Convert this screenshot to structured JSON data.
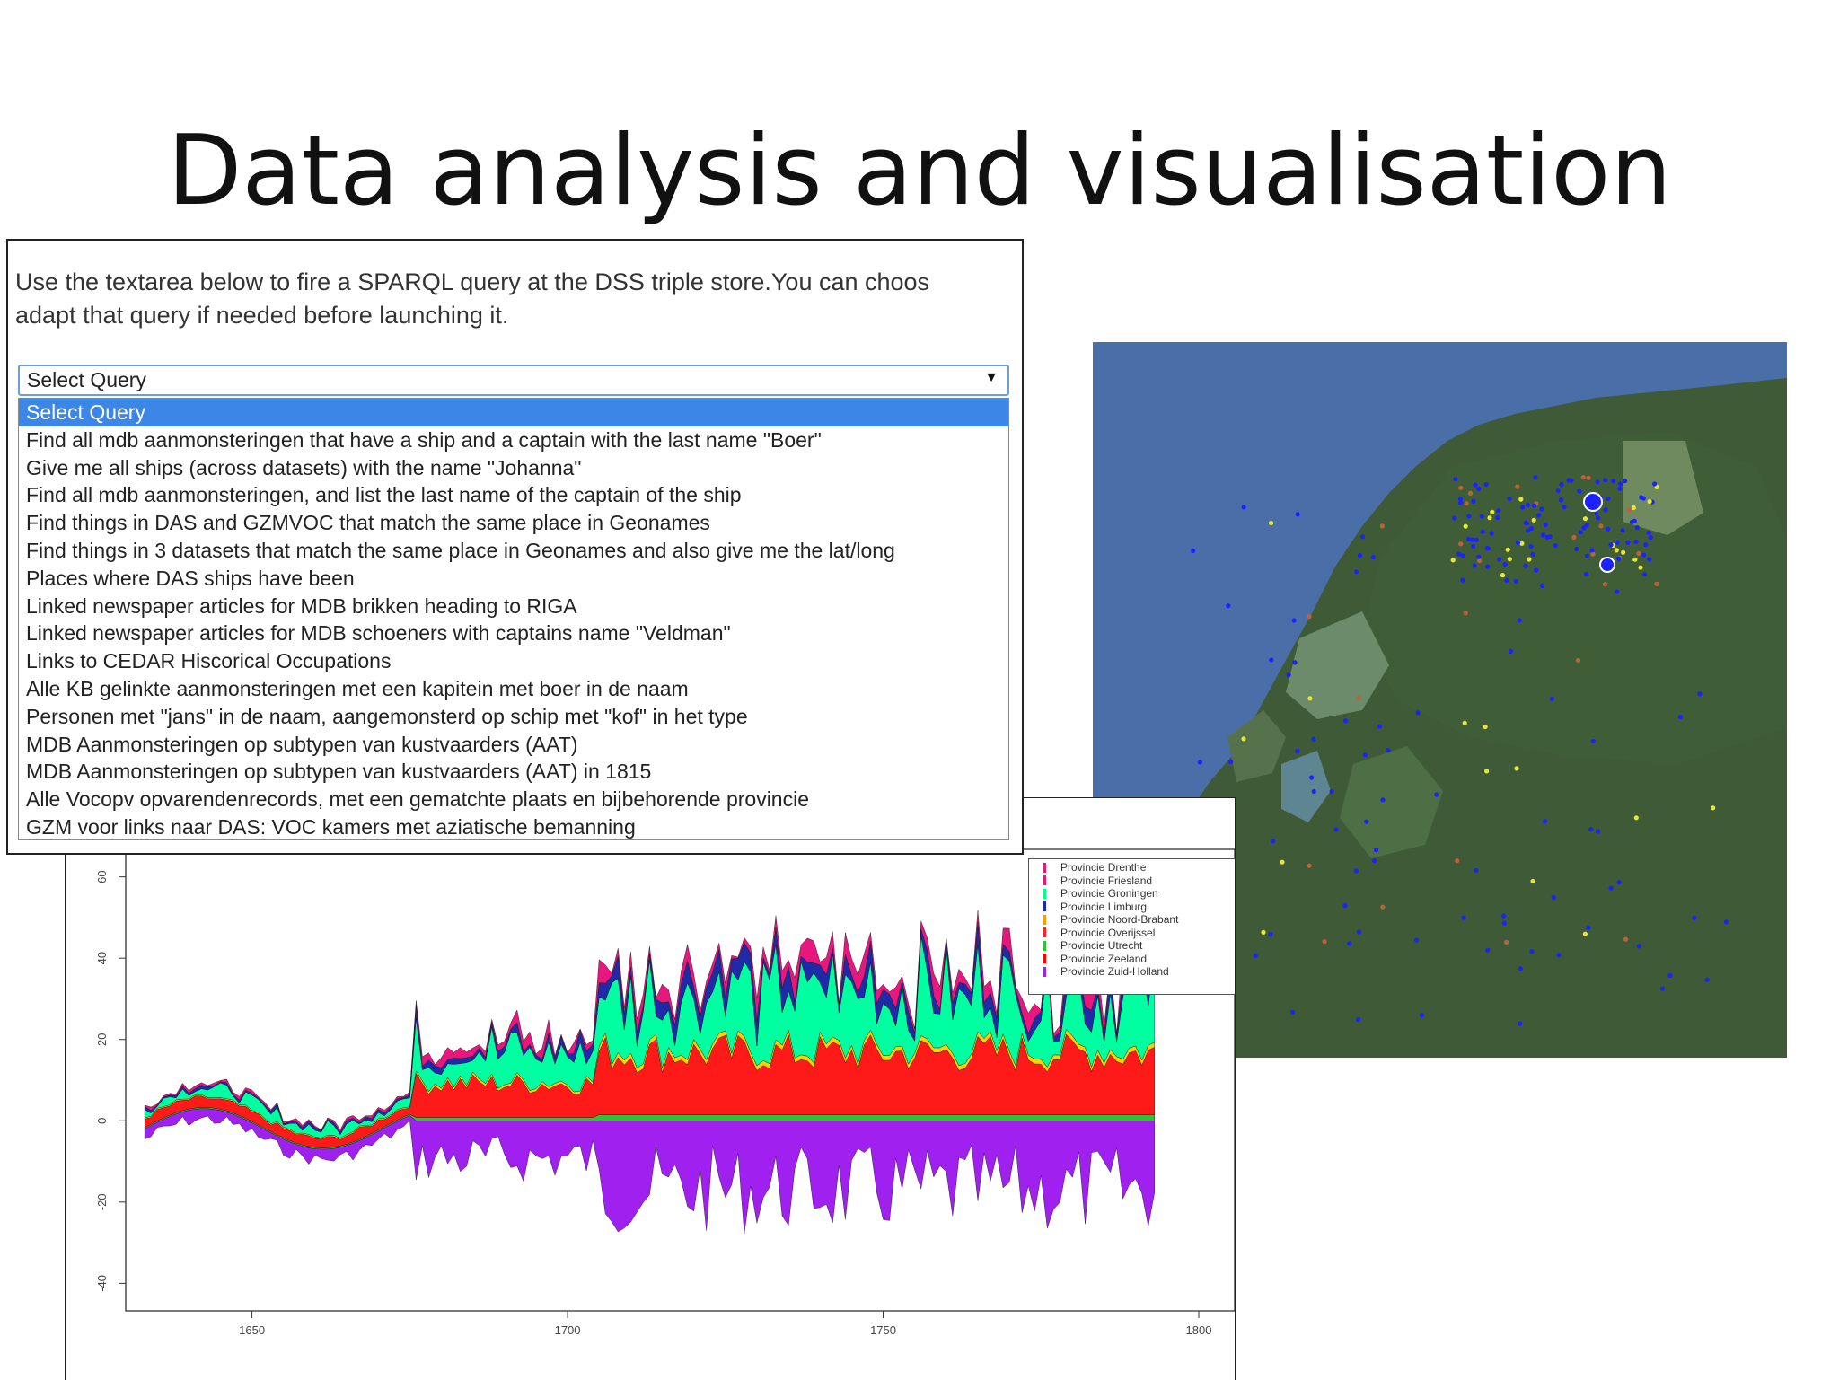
{
  "slide": {
    "title": "Data analysis and visualisation"
  },
  "query_panel": {
    "intro_line1": "Use the textarea below to fire a SPARQL query at the DSS triple store.You can choos",
    "intro_line2": "adapt that query if needed before launching it.",
    "select_value": "Select Query",
    "options": [
      "Select Query",
      "Find all mdb aanmonsteringen that have a ship and a captain with the last name \"Boer\"",
      "Give me all ships (across datasets) with the name \"Johanna\"",
      "Find all mdb aanmonsteringen, and list the last name of the captain of the ship",
      "Find things in DAS and GZMVOC that match the same place in Geonames",
      "Find things in 3 datasets that match the same place in Geonames and also give me the lat/long",
      "Places where DAS ships have been",
      "Linked newspaper articles for MDB brikken heading to RIGA",
      "Linked newspaper articles for MDB schoeners with captains name \"Veldman\"",
      "Links to CEDAR Hiscorical Occupations",
      "Alle KB gelinkte aanmonsteringen met een kapitein met boer in de naam",
      "Personen met \"jans\" in de naam, aangemonsterd op schip met \"kof\" in het type",
      "MDB Aanmonsteringen op subtypen van kustvaarders (AAT)",
      "MDB Aanmonsteringen op subtypen van kustvaarders (AAT) in 1815",
      "Alle Vocopv opvarendenrecords, met een gematchte plaats en bijbehorende provincie",
      "GZM voor links naar DAS: VOC kamers met aziatische bemanning"
    ],
    "selected_index": 0
  },
  "chart_data": {
    "type": "area",
    "xlim": [
      1630,
      1800
    ],
    "ylim": [
      -45,
      65
    ],
    "x_ticks": [
      1650,
      1700,
      1750,
      1800
    ],
    "y_ticks": [
      60,
      40,
      20,
      0,
      -20,
      -40
    ],
    "legend": [
      {
        "name": "Provincie Drenthe",
        "color": "#e8177e"
      },
      {
        "name": "Provincie Friesland",
        "color": "#e8177e"
      },
      {
        "name": "Provincie Groningen",
        "color": "#00ff99"
      },
      {
        "name": "Provincie Limburg",
        "color": "#1f2aa8"
      },
      {
        "name": "Provincie Noord-Brabant",
        "color": "#ff9a00"
      },
      {
        "name": "Provincie Overijssel",
        "color": "#ff2222"
      },
      {
        "name": "Provincie Utrecht",
        "color": "#2ec23a"
      },
      {
        "name": "Provincie Zeeland",
        "color": "#ff0000"
      },
      {
        "name": "Provincie Zuid-Holland",
        "color": "#a020f0"
      }
    ]
  },
  "colors": {
    "select_highlight": "#3b86e6",
    "sea": "#4a6fa8",
    "land": "#3e5a36"
  }
}
